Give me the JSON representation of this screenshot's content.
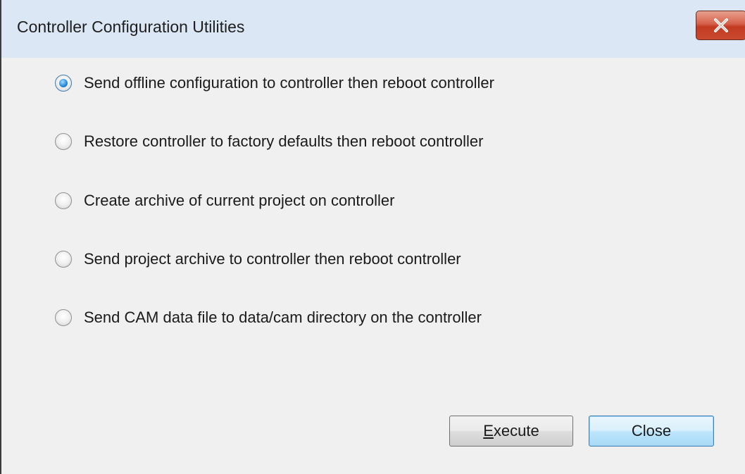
{
  "window": {
    "title": "Controller Configuration Utilities",
    "close_icon": "close-icon"
  },
  "options": [
    {
      "label": "Send offline configuration to controller then reboot controller",
      "checked": true
    },
    {
      "label": "Restore controller to factory defaults then reboot controller",
      "checked": false
    },
    {
      "label": "Create archive of current project on controller",
      "checked": false
    },
    {
      "label": "Send project archive to controller then reboot controller",
      "checked": false
    },
    {
      "label": "Send CAM data file to data/cam directory on the controller",
      "checked": false
    }
  ],
  "buttons": {
    "execute_mnemonic": "E",
    "execute_rest": "xecute",
    "close": "Close"
  },
  "colors": {
    "titlebar": "#dbe7f4",
    "body": "#f0f0f0",
    "close_button": "#c9492f",
    "radio_selected": "#2c8ee0"
  }
}
